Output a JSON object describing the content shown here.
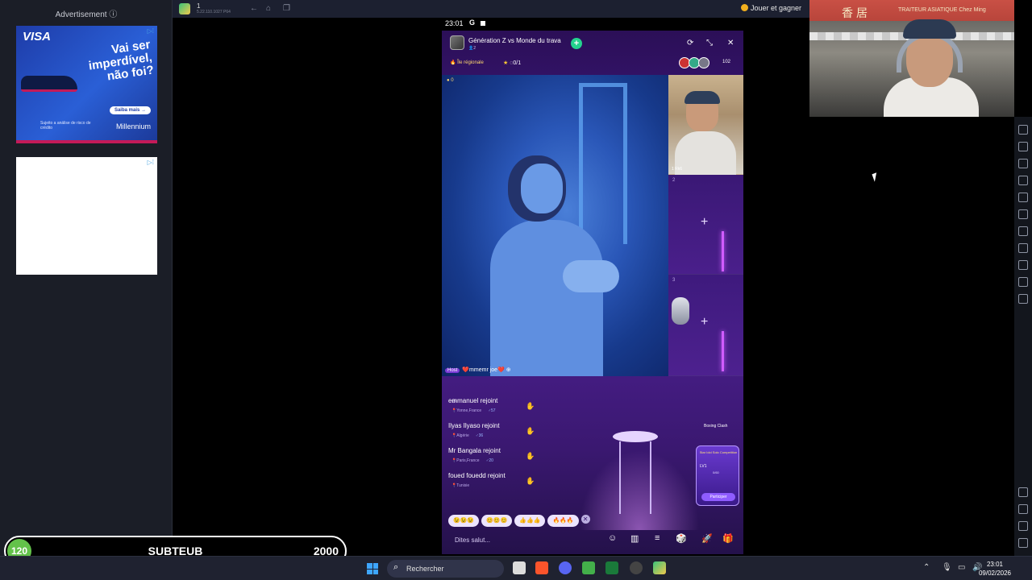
{
  "ad": {
    "title": "Advertisement ⓘ",
    "brand": "VISA",
    "headline": "Vai ser imperdível, não foi?",
    "button": "Saiba mais →",
    "disclaimer": "Sujeito a análise de risco de crédito",
    "sponsor": "Millennium"
  },
  "emulator": {
    "instance": "1",
    "version": "5.22.110.1027 P64",
    "play_earn": "Jouer et gagner"
  },
  "phone": {
    "time": "23:01",
    "room_title": "Génération Z vs Monde du trava",
    "room_tag": "Île régionale",
    "room_score": "0/1",
    "viewer_count": "102",
    "host_coins": "0",
    "host_name": "❤️mmemr joe❤️",
    "host_badge": "Host",
    "seat1_label": "1 Rk6",
    "seat2_num": "2",
    "seat3_num": "3",
    "chat": [
      {
        "text": "emmanuel rejoint",
        "location": "Yonne,France",
        "count": "57"
      },
      {
        "text": "Ilyas Ilyaso rejoint",
        "location": "Algérie",
        "count": "36"
      },
      {
        "text": "Mr Bangala rejoint",
        "location": "Paris,France",
        "count": "20"
      },
      {
        "text": "foued fouedd rejoint",
        "location": "Tunisie",
        "count": ""
      }
    ],
    "emoji_chips": [
      "😉😉😉",
      "😊😊😊",
      "👍👍👍",
      "🔥🔥🔥"
    ],
    "input_placeholder": "Dites salut...",
    "boxing": "Boxing Clash",
    "event_title": "Star Idol Solo Competition",
    "event_level": "LV1",
    "event_progress": "0/60",
    "event_button": "Participer"
  },
  "stream_overlay": {
    "count": "120",
    "name": "SUBTEUB",
    "goal": "2000"
  },
  "webcam": {
    "sign_chars": "香居",
    "sign_text": "TRAITEUR ASIATIQUE Chez Ming"
  },
  "taskbar": {
    "search": "Rechercher",
    "time": "23:01",
    "date": "09/02/2026"
  }
}
